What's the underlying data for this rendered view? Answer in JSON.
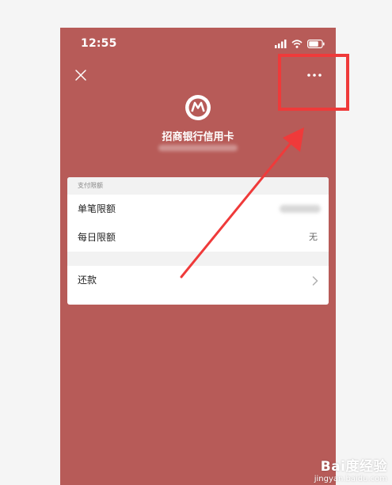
{
  "status_bar": {
    "time": "12:55"
  },
  "header": {
    "bank_name": "招商银行信用卡"
  },
  "payment_limits": {
    "section_title": "支付限额",
    "single_limit_label": "单笔限额",
    "daily_limit_label": "每日限额",
    "daily_limit_value": "无"
  },
  "repay": {
    "label": "还款"
  },
  "watermark": {
    "brand": "Bai度经验",
    "domain": "jingyan.baidu.com"
  },
  "colors": {
    "theme_background": "#b75b58",
    "annotation_red": "#ef3a3a"
  },
  "icons": {
    "close": "close-icon",
    "more": "more-icon",
    "logo": "cmb-logo-icon",
    "chevron": "chevron-right-icon"
  }
}
